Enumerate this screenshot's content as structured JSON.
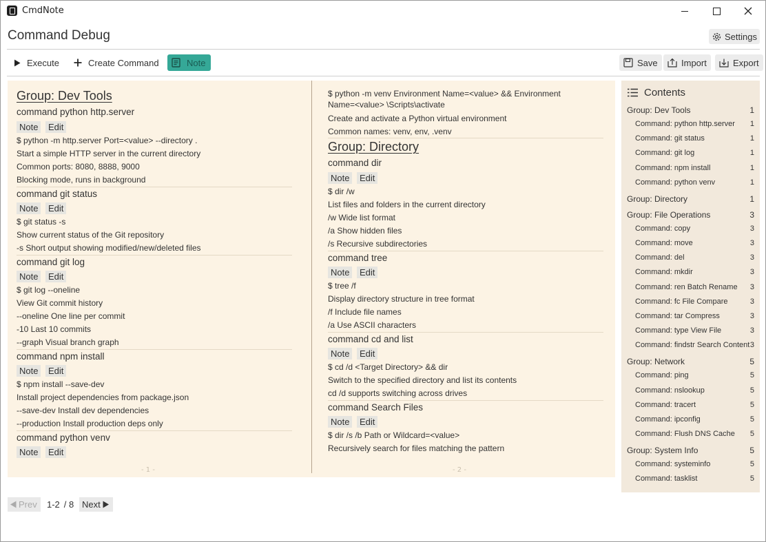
{
  "app": {
    "title": "CmdNote"
  },
  "header": {
    "page_title": "Command Debug",
    "settings_label": "Settings"
  },
  "toolbar": {
    "execute_label": "Execute",
    "create_label": "Create Command",
    "note_label": "Note",
    "save_label": "Save",
    "import_label": "Import",
    "export_label": "Export",
    "accent_color": "#35a897"
  },
  "notebook": {
    "left": {
      "group_title": "Group: Dev Tools",
      "commands": [
        {
          "title": "command python http.server",
          "note": "Note",
          "edit": "Edit",
          "lines": [
            "$ python -m http.server  Port=<value> --directory .",
            "Start a simple HTTP server in the current directory",
            "Common ports: 8080, 8888, 9000",
            "Blocking mode, runs in background"
          ]
        },
        {
          "title": "command git status",
          "note": "Note",
          "edit": "Edit",
          "lines": [
            "$ git status -s",
            "Show current status of the Git repository",
            "-s Short output showing modified/new/deleted files"
          ]
        },
        {
          "title": "command git log",
          "note": "Note",
          "edit": "Edit",
          "lines": [
            "$ git log --oneline",
            "View Git commit history",
            "--oneline One line per commit",
            "-10 Last 10 commits",
            "--graph Visual branch graph"
          ]
        },
        {
          "title": "command npm install",
          "note": "Note",
          "edit": "Edit",
          "lines": [
            "$ npm install --save-dev",
            "Install project dependencies from package.json",
            "--save-dev Install dev dependencies",
            "--production Install production deps only"
          ]
        },
        {
          "title": "command python venv",
          "note": "Note",
          "edit": "Edit",
          "lines": []
        }
      ],
      "page_num": "- 1 -"
    },
    "right": {
      "continued_lines": [
        "$ python -m venv  Environment Name=<value>  &&  Environment",
        "Name=<value> \\Scripts\\activate",
        "Create and activate a Python virtual environment",
        "Common names: venv, env, .venv"
      ],
      "group_title": "Group: Directory",
      "commands": [
        {
          "title": "command dir",
          "note": "Note",
          "edit": "Edit",
          "lines": [
            "$ dir /w",
            "List files and folders in the current directory",
            "/w Wide list format",
            "/a Show hidden files",
            "/s Recursive subdirectories"
          ]
        },
        {
          "title": "command tree",
          "note": "Note",
          "edit": "Edit",
          "lines": [
            "$ tree /f",
            "Display directory structure in tree format",
            "/f Include file names",
            "/a Use ASCII characters"
          ]
        },
        {
          "title": "command cd and list",
          "note": "Note",
          "edit": "Edit",
          "lines": [
            "$ cd /d  <Target Directory>  && dir",
            "Switch to the specified directory and list its contents",
            "cd /d supports switching across drives"
          ]
        },
        {
          "title": "command Search Files",
          "note": "Note",
          "edit": "Edit",
          "lines": [
            "$ dir /s /b  Path or Wildcard=<value>",
            "Recursively search for files matching the pattern"
          ]
        }
      ],
      "page_num": "- 2 -"
    }
  },
  "toc": {
    "title": "Contents",
    "items": [
      {
        "kind": "group",
        "label": "Group: Dev Tools",
        "page": "1"
      },
      {
        "kind": "cmd",
        "label": "Command: python http.server",
        "page": "1"
      },
      {
        "kind": "cmd",
        "label": "Command: git status",
        "page": "1"
      },
      {
        "kind": "cmd",
        "label": "Command: git log",
        "page": "1"
      },
      {
        "kind": "cmd",
        "label": "Command: npm install",
        "page": "1"
      },
      {
        "kind": "cmd",
        "label": "Command: python venv",
        "page": "1"
      },
      {
        "kind": "group",
        "label": "Group: Directory",
        "page": "1"
      },
      {
        "kind": "group",
        "label": "Group: File Operations",
        "page": "3"
      },
      {
        "kind": "cmd",
        "label": "Command: copy",
        "page": "3"
      },
      {
        "kind": "cmd",
        "label": "Command: move",
        "page": "3"
      },
      {
        "kind": "cmd",
        "label": "Command: del",
        "page": "3"
      },
      {
        "kind": "cmd",
        "label": "Command: mkdir",
        "page": "3"
      },
      {
        "kind": "cmd",
        "label": "Command: ren Batch Rename",
        "page": "3"
      },
      {
        "kind": "cmd",
        "label": "Command: fc File Compare",
        "page": "3"
      },
      {
        "kind": "cmd",
        "label": "Command: tar Compress",
        "page": "3"
      },
      {
        "kind": "cmd",
        "label": "Command: type View File",
        "page": "3"
      },
      {
        "kind": "cmd",
        "label": "Command: findstr Search Content",
        "page": "3"
      },
      {
        "kind": "group",
        "label": "Group: Network",
        "page": "5"
      },
      {
        "kind": "cmd",
        "label": "Command: ping",
        "page": "5"
      },
      {
        "kind": "cmd",
        "label": "Command: nslookup",
        "page": "5"
      },
      {
        "kind": "cmd",
        "label": "Command: tracert",
        "page": "5"
      },
      {
        "kind": "cmd",
        "label": "Command: ipconfig",
        "page": "5"
      },
      {
        "kind": "cmd",
        "label": "Command: Flush DNS Cache",
        "page": "5"
      },
      {
        "kind": "group",
        "label": "Group: System Info",
        "page": "5"
      },
      {
        "kind": "cmd",
        "label": "Command: systeminfo",
        "page": "5"
      },
      {
        "kind": "cmd",
        "label": "Command: tasklist",
        "page": "5"
      }
    ]
  },
  "pager": {
    "prev_label": "Prev",
    "next_label": "Next",
    "range": "1-2",
    "total": "/ 8"
  }
}
